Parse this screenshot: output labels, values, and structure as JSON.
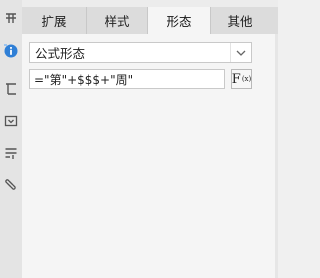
{
  "tabs": [
    {
      "label": "扩展",
      "active": false
    },
    {
      "label": "样式",
      "active": false
    },
    {
      "label": "形态",
      "active": true
    },
    {
      "label": "其他",
      "active": false
    }
  ],
  "form_type": {
    "selected": "公式形态"
  },
  "formula": {
    "value": "=\"第\"+$$$+\"周\""
  },
  "fx_button": {
    "main": "F",
    "sub": "(x)"
  },
  "sidebar": {
    "icons": [
      "grid-icon",
      "info-icon",
      "cell-icon",
      "dropdown-icon",
      "list-icon",
      "link-icon"
    ]
  },
  "colors": {
    "accent": "#2f7fd6",
    "active_tab": "#f5f5f5",
    "tab_bg": "#dcdcdc",
    "panel_bg": "#f5f5f5"
  }
}
